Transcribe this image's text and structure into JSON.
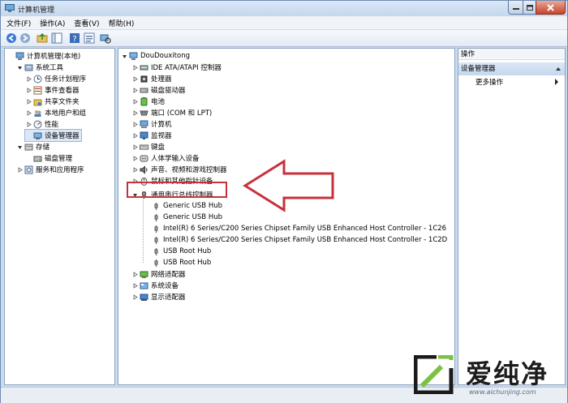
{
  "window": {
    "title": "计算机管理",
    "menu": [
      "文件(F)",
      "操作(A)",
      "查看(V)",
      "帮助(H)"
    ]
  },
  "left_tree": [
    {
      "label": "计算机管理(本地)",
      "level": 0,
      "arrow": "",
      "icon": "computer-management-icon"
    },
    {
      "label": "系统工具",
      "level": 1,
      "arrow": "down",
      "icon": "system-tools-icon"
    },
    {
      "label": "任务计划程序",
      "level": 2,
      "arrow": "right",
      "icon": "task-scheduler-icon"
    },
    {
      "label": "事件查看器",
      "level": 2,
      "arrow": "right",
      "icon": "event-viewer-icon"
    },
    {
      "label": "共享文件夹",
      "level": 2,
      "arrow": "right",
      "icon": "shared-folder-icon"
    },
    {
      "label": "本地用户和组",
      "level": 2,
      "arrow": "right",
      "icon": "users-groups-icon"
    },
    {
      "label": "性能",
      "level": 2,
      "arrow": "right",
      "icon": "performance-icon"
    },
    {
      "label": "设备管理器",
      "level": 2,
      "arrow": "",
      "icon": "device-manager-icon"
    },
    {
      "label": "存储",
      "level": 1,
      "arrow": "down",
      "icon": "storage-icon"
    },
    {
      "label": "磁盘管理",
      "level": 2,
      "arrow": "",
      "icon": "disk-management-icon"
    },
    {
      "label": "服务和应用程序",
      "level": 1,
      "arrow": "right",
      "icon": "services-apps-icon"
    }
  ],
  "device_tree": {
    "root": "DouDouxitong",
    "categories_top": [
      {
        "label": "IDE ATA/ATAPI 控制器",
        "icon": "ide-controller-icon"
      },
      {
        "label": "处理器",
        "icon": "processor-icon"
      },
      {
        "label": "磁盘驱动器",
        "icon": "disk-drive-icon"
      },
      {
        "label": "电池",
        "icon": "battery-icon"
      },
      {
        "label": "端口 (COM 和 LPT)",
        "icon": "port-icon"
      },
      {
        "label": "计算机",
        "icon": "computer-icon"
      },
      {
        "label": "监视器",
        "icon": "monitor-icon"
      },
      {
        "label": "键盘",
        "icon": "keyboard-icon"
      },
      {
        "label": "人体学输入设备",
        "icon": "hid-icon"
      },
      {
        "label": "声音、视频和游戏控制器",
        "icon": "sound-icon"
      },
      {
        "label": "鼠标和其他指针设备",
        "icon": "mouse-icon"
      }
    ],
    "usb_category": "通用串行总线控制器",
    "usb_children": [
      "Generic USB Hub",
      "Generic USB Hub",
      "Intel(R) 6 Series/C200 Series Chipset Family USB Enhanced Host Controller - 1C26",
      "Intel(R) 6 Series/C200 Series Chipset Family USB Enhanced Host Controller - 1C2D",
      "USB Root Hub",
      "USB Root Hub"
    ],
    "categories_bottom": [
      {
        "label": "网络适配器",
        "icon": "network-adapter-icon"
      },
      {
        "label": "系统设备",
        "icon": "system-device-icon"
      },
      {
        "label": "显示适配器",
        "icon": "display-adapter-icon"
      }
    ]
  },
  "actions_pane": {
    "header": "操作",
    "section": "设备管理器",
    "more": "更多操作"
  },
  "watermark": {
    "name": "爱纯净",
    "url": "www.aichunjing.com"
  },
  "colors": {
    "accent_red": "#c8313b",
    "window_frame": "#c9dbee"
  }
}
